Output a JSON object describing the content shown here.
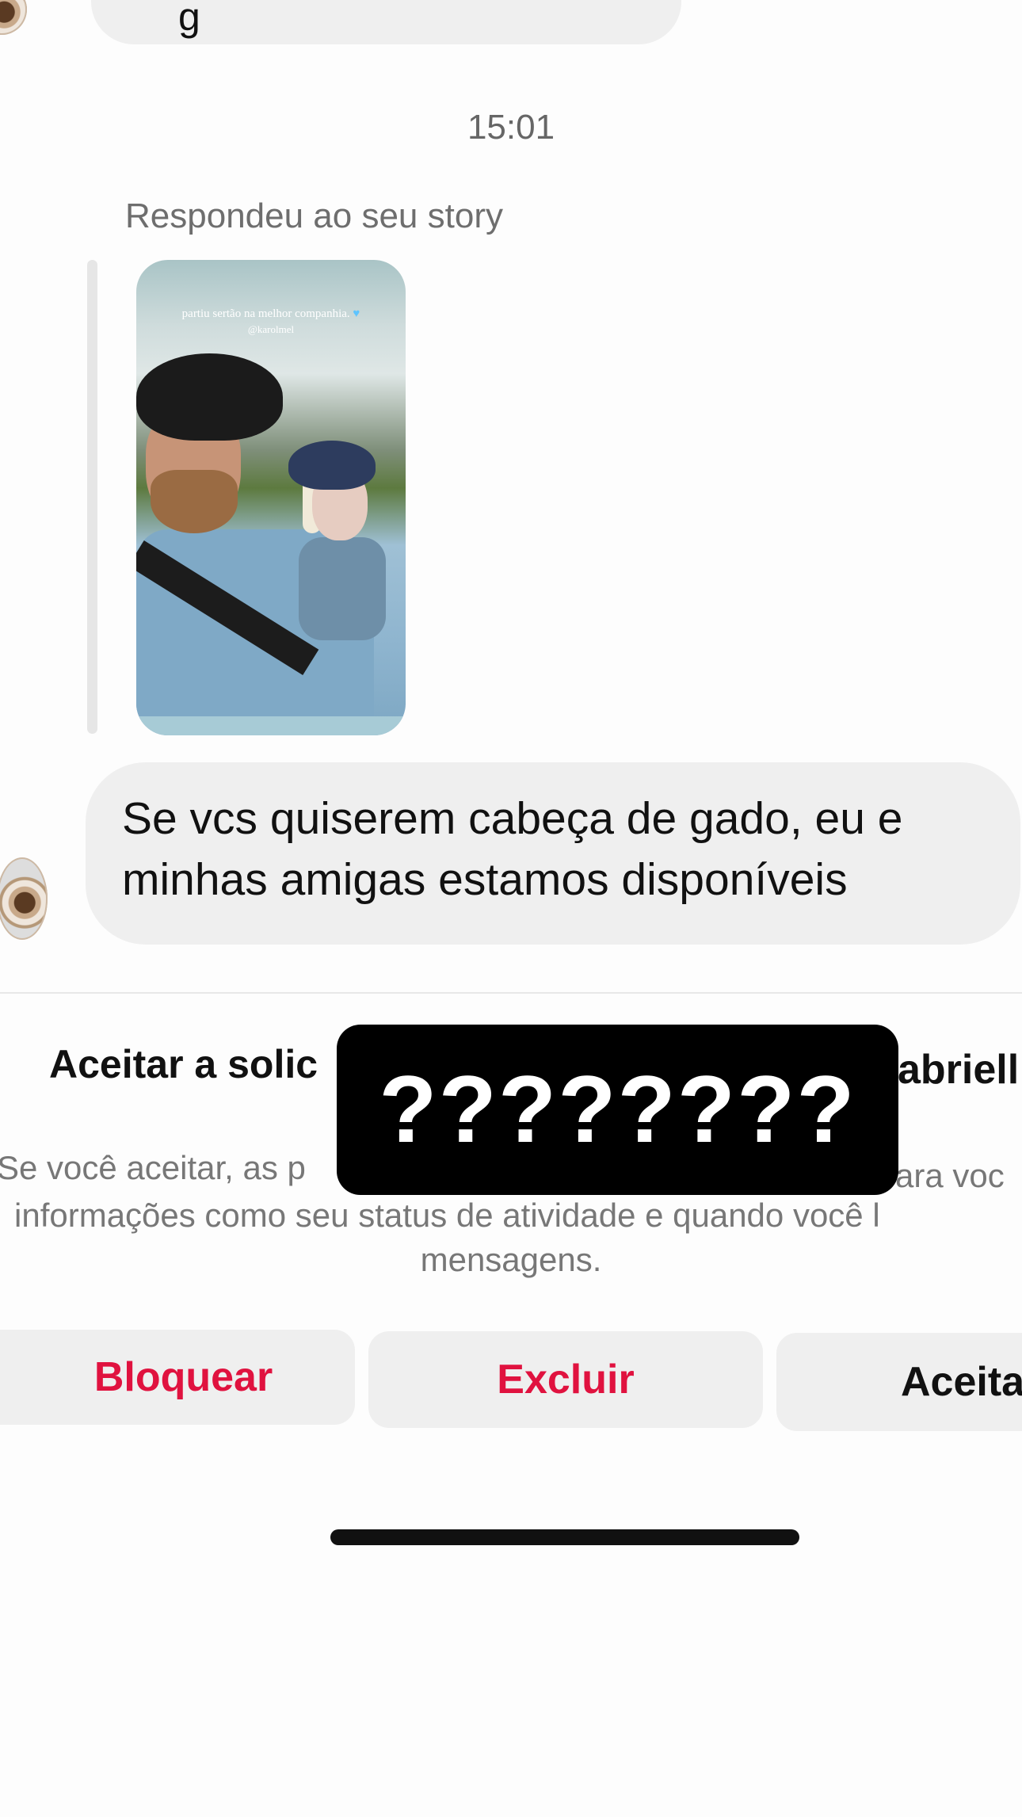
{
  "top_message": {
    "partial_text_left": "g",
    "partial_text_right": ""
  },
  "timestamp": "15:01",
  "story_reply": {
    "label": "Respondeu ao seu story",
    "story_caption_line1": "partiu sertão na melhor companhia.",
    "story_caption_line2": "@karolmel"
  },
  "message": {
    "text_line1": "Se vcs quiserem cabeça de gado, eu e",
    "text_line2": "minhas amigas estamos disponíveis"
  },
  "request_panel": {
    "title_left": "Aceitar a solic",
    "title_right": "abriell",
    "description_line1_left": "Se você aceitar, as p",
    "description_line1_right": "ara voc",
    "description_line2": "informações como seu status de atividade e quando você l",
    "description_line3": "mensagens."
  },
  "overlay_text": "????????",
  "buttons": {
    "block": "Bloquear",
    "delete": "Excluir",
    "accept": "Aceita"
  },
  "colors": {
    "destructive": "#e0123f",
    "bubble_bg": "#efefef",
    "overlay_bg": "#000000"
  }
}
